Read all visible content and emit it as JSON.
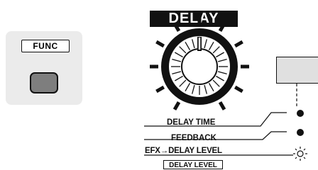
{
  "func_section": {
    "label": "FUNC",
    "button_color": "#7e7e7e"
  },
  "delay_section": {
    "title": "DELAY",
    "options": [
      {
        "label": "DELAY TIME",
        "indicator": "on"
      },
      {
        "label": "FEEDBACK",
        "indicator": "on"
      },
      {
        "label": "EFX→DELAY LEVEL",
        "indicator": "blinking"
      }
    ],
    "sub_label": "DELAY LEVEL"
  },
  "colors": {
    "panel_bg": "#ebebeb",
    "ink": "#111111",
    "button_gray": "#7e7e7e",
    "right_button_bg": "#e0e0e0"
  }
}
